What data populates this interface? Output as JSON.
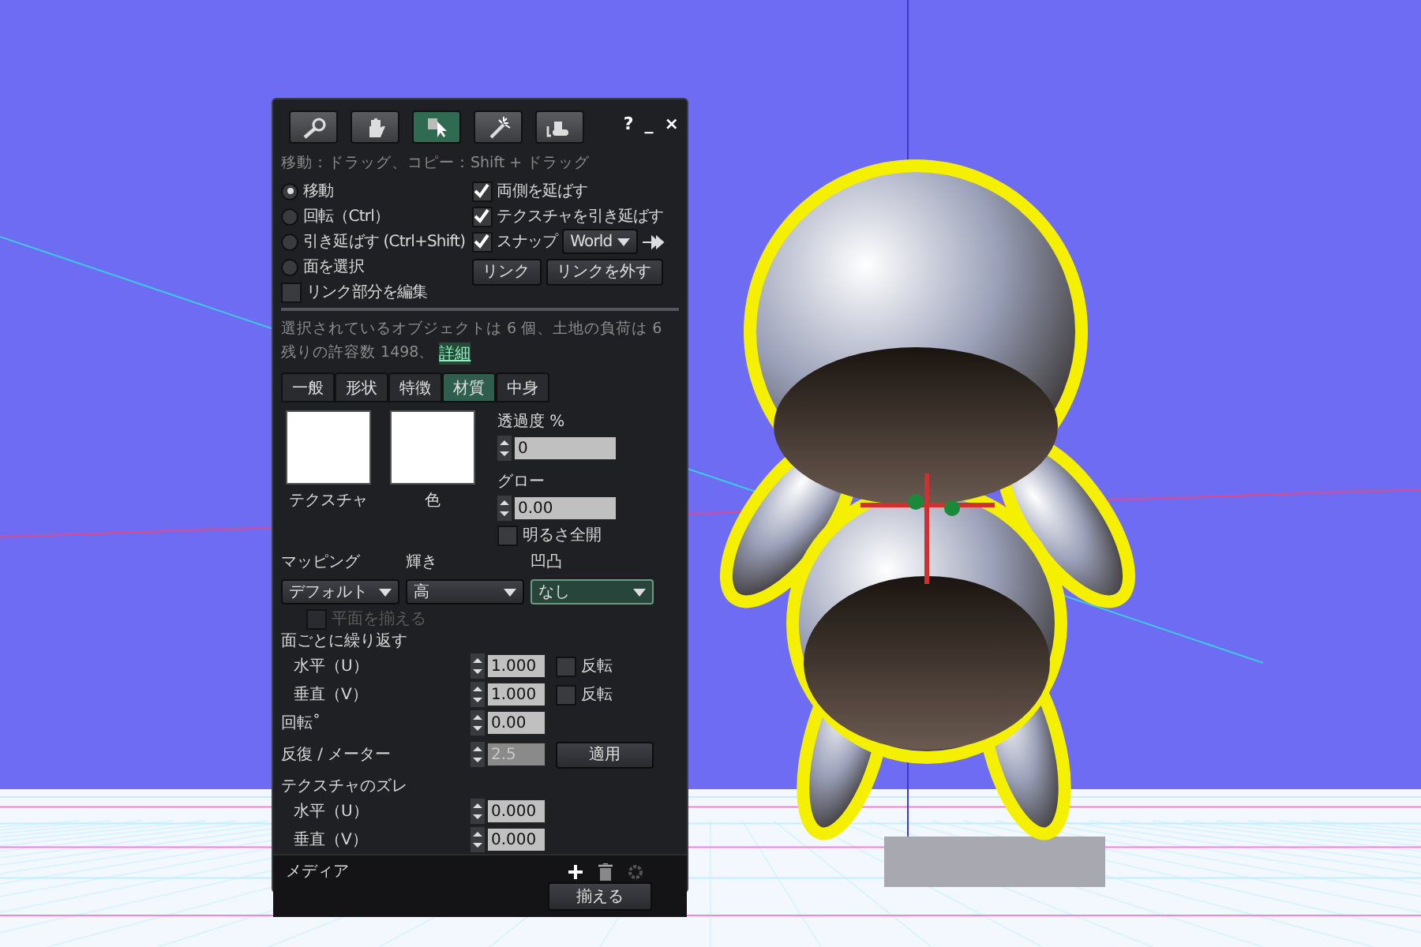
{
  "window": {
    "help": "?",
    "minimize": "_",
    "close": "×"
  },
  "tools": [
    {
      "kind": "magnifier",
      "selected": false
    },
    {
      "kind": "hand",
      "selected": false
    },
    {
      "kind": "pointer",
      "selected": true
    },
    {
      "kind": "wand",
      "selected": false
    },
    {
      "kind": "bulldozer",
      "selected": false
    }
  ],
  "hint": "移動：ドラッグ、コピー：Shift + ドラッグ",
  "modes": [
    {
      "label": "移動",
      "selected": true
    },
    {
      "label": "回転（Ctrl）",
      "selected": false
    },
    {
      "label": "引き延ばす (Ctrl+Shift)",
      "selected": false
    },
    {
      "label": "面を選択",
      "selected": false
    }
  ],
  "edit_linked": {
    "label": "リンク部分を編集",
    "checked": false
  },
  "options": [
    {
      "label": "両側を延ばす",
      "checked": true
    },
    {
      "label": "テクスチャを引き延ばす",
      "checked": true
    }
  ],
  "snap": {
    "label": "スナップ",
    "checked": true,
    "value": "World"
  },
  "link_buttons": [
    "リンク",
    "リンクを外す"
  ],
  "info": {
    "line_1": "選択されているオブジェクトは 6 個、土地の負荷は 6",
    "line_2": "残りの許容数 1498、",
    "link": "詳細"
  },
  "tabs": [
    {
      "label": "一般",
      "selected": false
    },
    {
      "label": "形状",
      "selected": false
    },
    {
      "label": "特徴",
      "selected": false
    },
    {
      "label": "材質",
      "selected": true
    },
    {
      "label": "中身",
      "selected": false
    }
  ],
  "swatches": [
    {
      "label": "テクスチャ"
    },
    {
      "label": "色"
    }
  ],
  "transparency": {
    "label": "透過度 %",
    "value": "0"
  },
  "glow": {
    "label": "グロー",
    "value": "0.00"
  },
  "fullbright": {
    "label": "明るさ全開",
    "checked": false
  },
  "dropdowns": [
    {
      "label": "マッピング",
      "value": "デフォルト",
      "focused": false
    },
    {
      "label": "輝き",
      "value": "高",
      "focused": false
    },
    {
      "label": "凹凸",
      "value": "なし",
      "focused": true
    }
  ],
  "align_planar": {
    "label": "平面を揃える",
    "checked": false,
    "disabled": true
  },
  "repeats": {
    "title": "面ごとに繰り返す",
    "rows": [
      {
        "label": "水平（U）",
        "value": "1.000",
        "flip_label": "反転",
        "flip": false
      },
      {
        "label": "垂直（V）",
        "value": "1.000",
        "flip_label": "反転",
        "flip": false
      }
    ]
  },
  "rotation": {
    "label": "回転˚",
    "value": "0.00"
  },
  "repeats_per_meter": {
    "label": "反復 / メーター",
    "value": "2.5",
    "disabled": true,
    "button": "適用"
  },
  "offset": {
    "title": "テクスチャのズレ",
    "rows": [
      {
        "label": "水平（U）",
        "value": "0.000"
      },
      {
        "label": "垂直（V）",
        "value": "0.000"
      }
    ]
  },
  "media": {
    "label": "メディア",
    "gear_disabled": true,
    "button": "揃える"
  }
}
